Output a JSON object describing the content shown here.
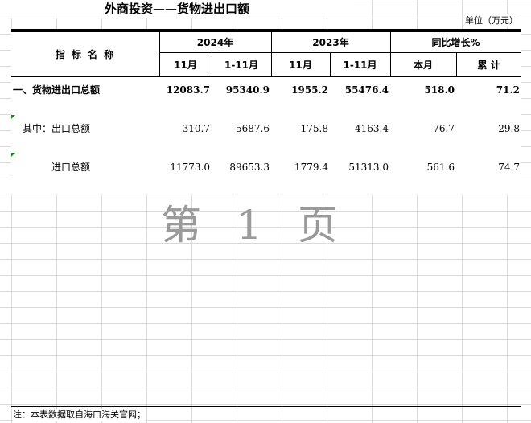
{
  "title": "外商投资——货物进出口额",
  "unit": "单位（万元）",
  "header": {
    "indicator": "指 标 名 称",
    "y2024": "2024年",
    "y2023": "2023年",
    "yoy": "同比增长%",
    "m_2024": "11月",
    "ytd_2024": "1-11月",
    "m_2023": "11月",
    "ytd_2023": "1-11月",
    "this_month": "本月",
    "cumulative": "累 计"
  },
  "rows": [
    {
      "label": "一、货物进出口总额",
      "v2024m": "12083.7",
      "v2024ytd": "95340.9",
      "v2023m": "1955.2",
      "v2023ytd": "55476.4",
      "yoy_m": "518.0",
      "yoy_cum": "71.2"
    },
    {
      "label": "其中：出口总额",
      "v2024m": "310.7",
      "v2024ytd": "5687.6",
      "v2023m": "175.8",
      "v2023ytd": "4163.4",
      "yoy_m": "76.7",
      "yoy_cum": "29.8"
    },
    {
      "label": "进口总额",
      "v2024m": "11773.0",
      "v2024ytd": "89653.3",
      "v2023m": "1779.4",
      "v2023ytd": "51313.0",
      "yoy_m": "561.6",
      "yoy_cum": "74.7"
    }
  ],
  "watermark": "第 1 页",
  "footer": "注：本表数据取自海口海关官网；",
  "colors": {
    "indicator_triangle": "#1a8a1a",
    "watermark": "#9a9a9a"
  }
}
